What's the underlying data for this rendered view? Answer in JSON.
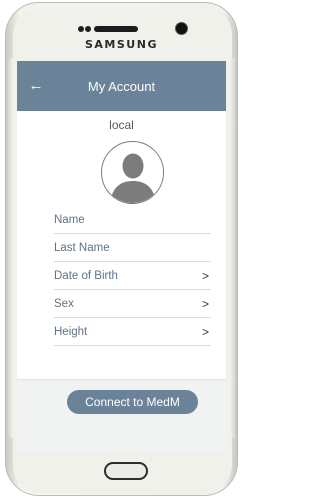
{
  "device": {
    "brand": "SAMSUNG"
  },
  "appbar": {
    "back_icon": "arrow-left-icon",
    "back_glyph": "←",
    "title": "My Account"
  },
  "profile": {
    "username": "local",
    "avatar_icon": "user-silhouette-icon"
  },
  "fields": [
    {
      "label": "Name",
      "has_chevron": false
    },
    {
      "label": "Last Name",
      "has_chevron": false
    },
    {
      "label": "Date of Birth",
      "has_chevron": true
    },
    {
      "label": "Sex",
      "has_chevron": true
    },
    {
      "label": "Height",
      "has_chevron": true
    }
  ],
  "chevron_glyph": ">",
  "actions": {
    "connect_label": "Connect to MedM"
  },
  "colors": {
    "accent": "#6a8399",
    "field_label": "#5f7387",
    "footer_bg": "#f1f2f2"
  }
}
